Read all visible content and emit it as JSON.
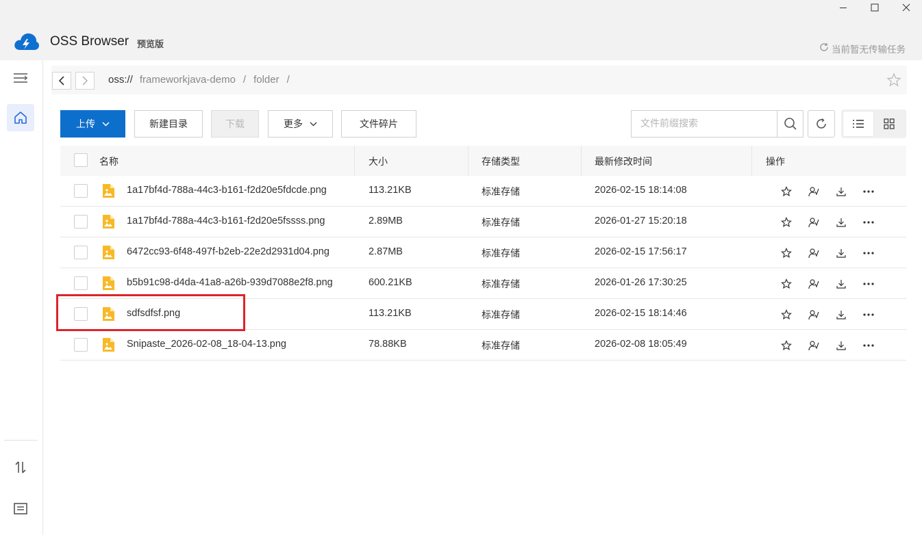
{
  "app": {
    "title": "OSS Browser",
    "badge": "预览版",
    "transfer_status": "当前暂无传输任务"
  },
  "path": {
    "scheme": "oss://",
    "segments": [
      "frameworkjava-demo",
      "folder"
    ],
    "sep": "/"
  },
  "toolbar": {
    "upload": "上传",
    "new_dir": "新建目录",
    "download": "下载",
    "more": "更多",
    "fragments": "文件碎片",
    "search_placeholder": "文件前缀搜索"
  },
  "table": {
    "headers": {
      "name": "名称",
      "size": "大小",
      "storage": "存储类型",
      "modified": "最新修改时间",
      "actions": "操作"
    },
    "rows": [
      {
        "name": "1a17bf4d-788a-44c3-b161-f2d20e5fdcde.png",
        "size": "113.21KB",
        "storage": "标准存储",
        "modified": "2026-02-15 18:14:08"
      },
      {
        "name": "1a17bf4d-788a-44c3-b161-f2d20e5fssss.png",
        "size": "2.89MB",
        "storage": "标准存储",
        "modified": "2026-01-27 15:20:18"
      },
      {
        "name": "6472cc93-6f48-497f-b2eb-22e2d2931d04.png",
        "size": "2.87MB",
        "storage": "标准存储",
        "modified": "2026-02-15 17:56:17"
      },
      {
        "name": "b5b91c98-d4da-41a8-a26b-939d7088e2f8.png",
        "size": "600.21KB",
        "storage": "标准存储",
        "modified": "2026-01-26 17:30:25"
      },
      {
        "name": "sdfsdfsf.png",
        "size": "113.21KB",
        "storage": "标准存储",
        "modified": "2026-02-15 18:14:46"
      },
      {
        "name": "Snipaste_2026-02-08_18-04-13.png",
        "size": "78.88KB",
        "storage": "标准存储",
        "modified": "2026-02-08 18:05:49"
      }
    ]
  },
  "colors": {
    "primary": "#0d6fcc",
    "highlight": "#e0222a",
    "file_icon": "#f7b928"
  },
  "icons": [
    "cloud-logo-icon",
    "menu-icon",
    "home-icon",
    "transfer-icon",
    "message-icon",
    "star-icon",
    "share-icon",
    "download-icon",
    "more-icon",
    "search-icon",
    "refresh-icon",
    "list-view-icon",
    "grid-view-icon"
  ]
}
